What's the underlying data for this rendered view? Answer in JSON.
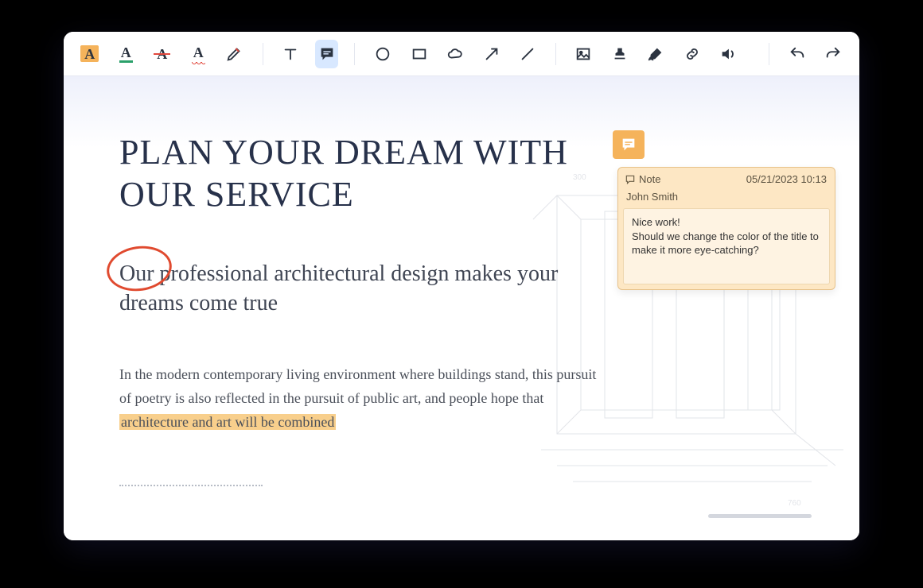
{
  "toolbar": {
    "highlight": "A",
    "underline": "A",
    "strike": "A",
    "squiggle": "A"
  },
  "document": {
    "title": "PLAN YOUR DREAM WITH OUR SERVICE",
    "subtitle": "Our professional architectural design makes your dreams come true",
    "body_pre": "In the modern contemporary living environment where buildings stand, this pursuit of poetry is also reflected in the pursuit of public art, and people hope that ",
    "body_highlight": "architecture and art will be combined"
  },
  "note": {
    "label": "Note",
    "timestamp": "05/21/2023 10:13",
    "author": "John Smith",
    "line1": "Nice work!",
    "line2": "Should we change the color of the title to make it more eye-catching?"
  }
}
